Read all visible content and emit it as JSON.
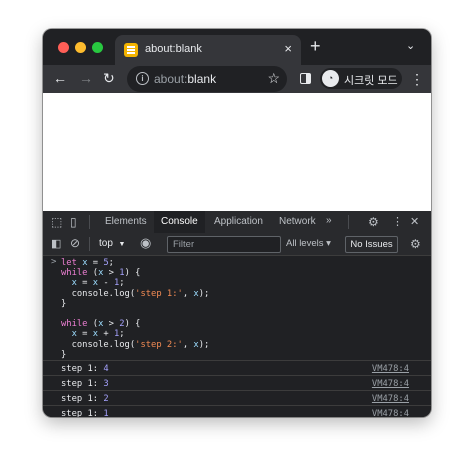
{
  "browser": {
    "tab": {
      "title": "about:blank",
      "close_glyph": "×"
    },
    "new_tab_glyph": "+",
    "tab_list_glyph": "⌄",
    "nav": {
      "back_glyph": "←",
      "forward_glyph": "→",
      "reload_glyph": "↻"
    },
    "omnibox": {
      "prefix": "about:",
      "text": "blank",
      "info_glyph": "i",
      "star_glyph": "☆"
    },
    "incognito": {
      "label": "시크릿 모드",
      "avatar_glyph": "◔"
    },
    "menu_glyph": "⋮"
  },
  "devtools": {
    "tabs": [
      "Elements",
      "Console",
      "Application",
      "Network"
    ],
    "active_tab": "Console",
    "more_tabs_glyph": "»",
    "toolbar": {
      "context": "top",
      "context_arrow": "▼",
      "filter_placeholder": "Filter",
      "levels": "All levels ▾",
      "issues": "No Issues"
    },
    "console": {
      "prompt_glyph": ">",
      "code": [
        [
          {
            "t": "let",
            "c": "kw"
          },
          {
            "t": " "
          },
          {
            "t": "x",
            "c": "var"
          },
          {
            "t": " = "
          },
          {
            "t": "5",
            "c": "num"
          },
          {
            "t": ";"
          }
        ],
        [
          {
            "t": "while",
            "c": "kw"
          },
          {
            "t": " ("
          },
          {
            "t": "x",
            "c": "var"
          },
          {
            "t": " > "
          },
          {
            "t": "1",
            "c": "num"
          },
          {
            "t": ") {"
          }
        ],
        [
          {
            "t": "  "
          },
          {
            "t": "x",
            "c": "var"
          },
          {
            "t": " = "
          },
          {
            "t": "x",
            "c": "var"
          },
          {
            "t": " - "
          },
          {
            "t": "1",
            "c": "num"
          },
          {
            "t": ";"
          }
        ],
        [
          {
            "t": "  console.log("
          },
          {
            "t": "'step 1:'",
            "c": "str"
          },
          {
            "t": ", "
          },
          {
            "t": "x",
            "c": "var"
          },
          {
            "t": ");"
          }
        ],
        [
          {
            "t": "}"
          }
        ],
        [
          {
            "t": ""
          }
        ],
        [
          {
            "t": "while",
            "c": "kw"
          },
          {
            "t": " ("
          },
          {
            "t": "x",
            "c": "var"
          },
          {
            "t": " > "
          },
          {
            "t": "2",
            "c": "num"
          },
          {
            "t": ") {"
          }
        ],
        [
          {
            "t": "  "
          },
          {
            "t": "x",
            "c": "var"
          },
          {
            "t": " = "
          },
          {
            "t": "x",
            "c": "var"
          },
          {
            "t": " + "
          },
          {
            "t": "1",
            "c": "num"
          },
          {
            "t": ";"
          }
        ],
        [
          {
            "t": "  console.log("
          },
          {
            "t": "'step 2:'",
            "c": "str"
          },
          {
            "t": ", "
          },
          {
            "t": "x",
            "c": "var"
          },
          {
            "t": ");"
          }
        ],
        [
          {
            "t": "}"
          }
        ]
      ],
      "logs": [
        {
          "label": "step 1:",
          "value": "4",
          "source": "VM478:4"
        },
        {
          "label": "step 1:",
          "value": "3",
          "source": "VM478:4"
        },
        {
          "label": "step 1:",
          "value": "2",
          "source": "VM478:4"
        },
        {
          "label": "step 1:",
          "value": "1",
          "source": "VM478:4"
        }
      ]
    }
  }
}
